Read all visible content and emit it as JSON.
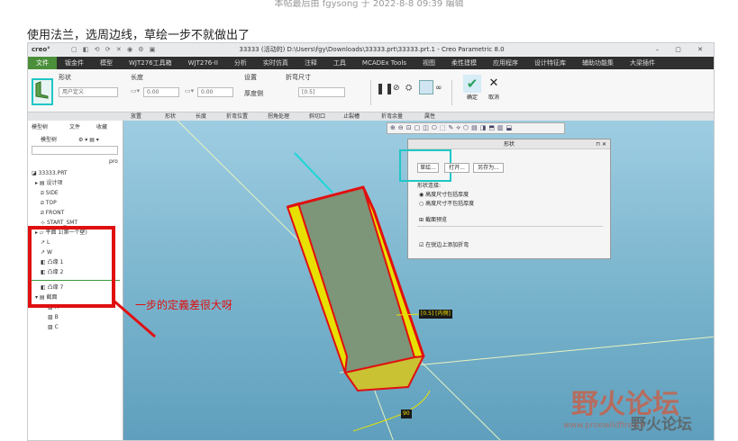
{
  "header_text": "本帖最后由 fgysong 于 2022-8-8 09:39 编辑",
  "post_text": "使用法兰，选周边线，草绘一步不就做出了",
  "app": {
    "logo": "creo°",
    "title": "33333 (活动的) D:\\Users\\fgy\\Downloads\\33333.prt\\33333.prt.1 - Creo Parametric 8.0",
    "window_controls": "– ▢ ✕"
  },
  "menu": [
    "文件",
    "钣金件",
    "模型",
    "WJT276工具箱",
    "WJT276-II",
    "分析",
    "实时仿真",
    "注释",
    "工具",
    "MCADEx Tools",
    "视图",
    "柔性建模",
    "应用程序",
    "设计特征库",
    "辅助功能集",
    "大梁插件"
  ],
  "ribbon": {
    "shape_label": "形状",
    "shape_value": "用户定义",
    "length_label": "长度",
    "length_value": "0.00",
    "length_value2": "0.00",
    "setting_label": "设置",
    "thickness_side": "厚度侧",
    "bend_radius_label": "折弯尺寸",
    "bend_radius_value": "[0.5]",
    "ok_label": "确定",
    "cancel_label": "取消"
  },
  "subtabs": [
    "放置",
    "形状",
    "长度",
    "折弯位置",
    "拐角处理",
    "斜切口",
    "止裂槽",
    "折弯余量",
    "属性"
  ],
  "tree": {
    "tabs": [
      "模型树",
      "文件",
      "收藏"
    ],
    "label_model_tree": "模型树",
    "col_label": "pro",
    "items": [
      {
        "label": "33333.PRT",
        "indent": 0,
        "icon": "part"
      },
      {
        "label": "设计项",
        "indent": 1,
        "icon": "folder"
      },
      {
        "label": "SIDE",
        "indent": 1,
        "icon": "plane"
      },
      {
        "label": "TOP",
        "indent": 1,
        "icon": "plane"
      },
      {
        "label": "FRONT",
        "indent": 1,
        "icon": "plane"
      },
      {
        "label": "START_SMT",
        "indent": 1,
        "icon": "csys"
      },
      {
        "label": "平面 1(第一个壁)",
        "indent": 1,
        "icon": "wall"
      },
      {
        "label": "L",
        "indent": 1,
        "icon": "dim"
      },
      {
        "label": "W",
        "indent": 1,
        "icon": "dim"
      },
      {
        "label": "凸缘 1",
        "indent": 1,
        "icon": "flange"
      },
      {
        "label": "凸缘 2",
        "indent": 1,
        "icon": "flange"
      },
      {
        "label": "凸缘 7",
        "indent": 1,
        "icon": "flange"
      },
      {
        "label": "截面",
        "indent": 1,
        "icon": "folder"
      },
      {
        "label": "A",
        "indent": 2,
        "icon": "section"
      },
      {
        "label": "B",
        "indent": 2,
        "icon": "section"
      },
      {
        "label": "C",
        "indent": 2,
        "icon": "section"
      }
    ]
  },
  "dialog": {
    "title": "形状",
    "sketch_button": "草绘...",
    "open_button": "打开...",
    "save_as_button": "另存为...",
    "shape_connect_label": "形状连接:",
    "radio1": "高度尺寸包括厚度",
    "radio2": "高度尺寸不包括厚度",
    "section_preview": "截面预览",
    "checkbox_label": "在锐边上添加折弯"
  },
  "dims": {
    "bend": "[0.5]",
    "bend_tag": "[内侧]",
    "angle": "90"
  },
  "annotation": "一步的定義差很大呀",
  "watermark": {
    "title": "野火论坛",
    "url": "www.proewildfire.cn"
  },
  "colors": {
    "active_menu": "#4b8f3a",
    "highlight_red": "#e01010",
    "cyan_box": "#20c6c6",
    "viewport": "#78b3cc"
  }
}
